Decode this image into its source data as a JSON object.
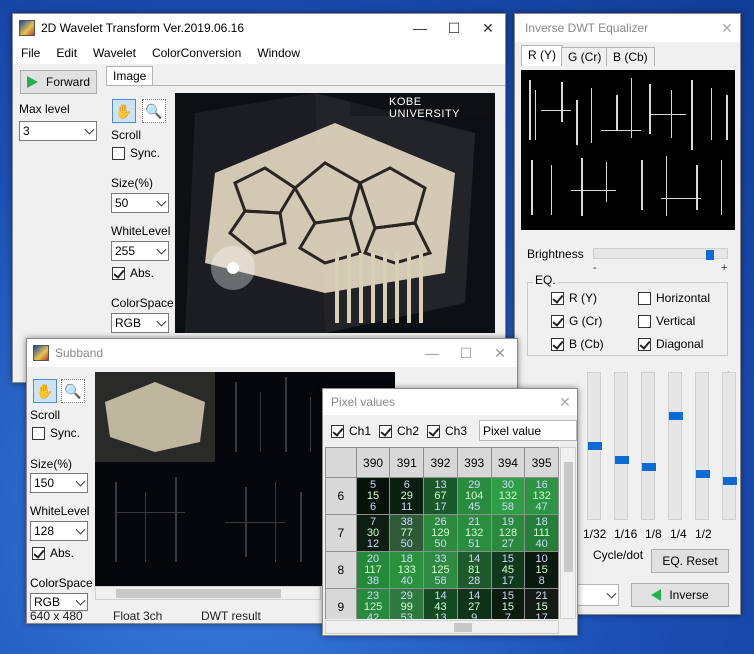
{
  "main_window": {
    "title": "2D Wavelet Transform Ver.2019.06.16",
    "menu": [
      "File",
      "Edit",
      "Wavelet",
      "ColorConversion",
      "Window"
    ],
    "forward_label": "Forward",
    "max_level_label": "Max level",
    "max_level_value": "3",
    "tab_label": "Image",
    "scroll_label": "Scroll",
    "sync_label": "Sync.",
    "size_label": "Size(%)",
    "size_value": "50",
    "white_level_label": "WhiteLevel",
    "white_level_value": "255",
    "abs_label": "Abs.",
    "colorspace_label": "ColorSpace",
    "colorspace_value": "RGB",
    "watermark": "KOBE UNIVERSITY"
  },
  "equalizer": {
    "title": "Inverse DWT Equalizer",
    "tabs": [
      "R (Y)",
      "G (Cr)",
      "B (Cb)"
    ],
    "brightness_label": "Brightness",
    "brightness_minus": "-",
    "brightness_plus": "+",
    "brightness_level": 0.88,
    "eq_label": "EQ.",
    "channels": [
      {
        "label": "R (Y)",
        "checked": true
      },
      {
        "label": "G (Cr)",
        "checked": true
      },
      {
        "label": "B (Cb)",
        "checked": true
      }
    ],
    "directions": [
      {
        "label": "Horizontal",
        "checked": false
      },
      {
        "label": "Vertical",
        "checked": false
      },
      {
        "label": "Diagonal",
        "checked": true
      }
    ],
    "plus": "+",
    "minus": "-",
    "band_labels": [
      "1/32",
      "1/16",
      "1/8",
      "1/4",
      "1/2"
    ],
    "band_levels": [
      0.5,
      0.4,
      0.35,
      0.72,
      0.3,
      0.25
    ],
    "cycle_label": "Cycle/dot",
    "reset_label": "EQ. Reset",
    "inverse_label": "Inverse"
  },
  "subband": {
    "title": "Subband",
    "scroll_label": "Scroll",
    "sync_label": "Sync.",
    "size_label": "Size(%)",
    "size_value": "150",
    "white_level_label": "WhiteLevel",
    "white_level_value": "128",
    "abs_label": "Abs.",
    "colorspace_label": "ColorSpace",
    "colorspace_value": "RGB",
    "status": [
      "640 x 480",
      "Float 3ch",
      "DWT result"
    ]
  },
  "pixel_values": {
    "title": "Pixel values",
    "ch1": "Ch1",
    "ch2": "Ch2",
    "ch3": "Ch3",
    "mode": "Pixel value",
    "columns": [
      "390",
      "391",
      "392",
      "393",
      "394",
      "395"
    ],
    "rows": [
      {
        "label": "6",
        "cells": [
          [
            "5",
            "15",
            "6"
          ],
          [
            "6",
            "29",
            "11"
          ],
          [
            "13",
            "67",
            "17"
          ],
          [
            "29",
            "104",
            "45"
          ],
          [
            "30",
            "132",
            "58"
          ],
          [
            "16",
            "132",
            "47"
          ]
        ]
      },
      {
        "label": "7",
        "cells": [
          [
            "7",
            "30",
            "12"
          ],
          [
            "38",
            "77",
            "50"
          ],
          [
            "26",
            "129",
            "50"
          ],
          [
            "21",
            "132",
            "51"
          ],
          [
            "19",
            "128",
            "27"
          ],
          [
            "18",
            "111",
            "40"
          ]
        ]
      },
      {
        "label": "8",
        "cells": [
          [
            "20",
            "117",
            "38"
          ],
          [
            "18",
            "133",
            "40"
          ],
          [
            "33",
            "125",
            "58"
          ],
          [
            "14",
            "81",
            "28"
          ],
          [
            "15",
            "45",
            "17"
          ],
          [
            "10",
            "15",
            "8"
          ]
        ]
      },
      {
        "label": "9",
        "cells": [
          [
            "23",
            "125",
            "42"
          ],
          [
            "29",
            "99",
            "53"
          ],
          [
            "14",
            "43",
            "13"
          ],
          [
            "14",
            "27",
            "9"
          ],
          [
            "15",
            "15",
            "7"
          ],
          [
            "21",
            "15",
            "17"
          ]
        ]
      }
    ],
    "greens": [
      [
        "#06130a",
        "#0b1f10",
        "#1a5a2a",
        "#2a8a3e",
        "#2f9f45",
        "#2c9542"
      ],
      [
        "#0d1f12",
        "#2f5a38",
        "#2b8a3e",
        "#2a8d3f",
        "#2a8a3b",
        "#248038"
      ],
      [
        "#248a39",
        "#2a923d",
        "#2f8a42",
        "#1e5a2b",
        "#103a1c",
        "#0b1a0e"
      ],
      [
        "#278a3c",
        "#2f7a3f",
        "#144a22",
        "#0f3318",
        "#0c1d10",
        "#141a14"
      ]
    ]
  },
  "colors": {
    "accent": "#0a6ad6",
    "play": "#22b14c"
  }
}
